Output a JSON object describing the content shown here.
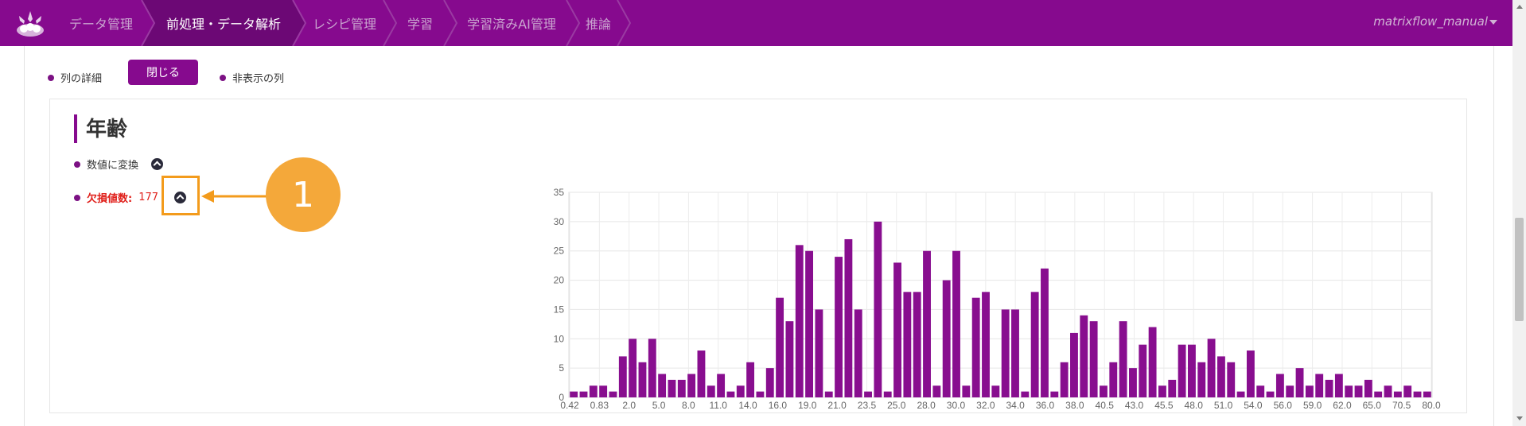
{
  "nav": {
    "items": [
      {
        "label": "データ管理",
        "active": false
      },
      {
        "label": "前処理・データ解析",
        "active": true
      },
      {
        "label": "レシピ管理",
        "active": false
      },
      {
        "label": "学習",
        "active": false
      },
      {
        "label": "学習済みAI管理",
        "active": false
      },
      {
        "label": "推論",
        "active": false
      }
    ],
    "user": "matrixflow_manual"
  },
  "toolbar": {
    "column_detail": "列の詳細",
    "close_button": "閉じる",
    "hidden_columns": "非表示の列"
  },
  "column": {
    "title": "年齢",
    "convert_numeric": "数値に変換",
    "missing_label": "欠損値数:",
    "missing_count": "177"
  },
  "annotation": {
    "number": "1"
  },
  "colors": {
    "brand": "#860a8e",
    "bar": "#880e8f",
    "accent": "#f4a83a"
  },
  "chart_data": {
    "type": "bar",
    "x_tick_labels": [
      "0.42",
      "0.83",
      "2.0",
      "5.0",
      "8.0",
      "11.0",
      "14.0",
      "16.0",
      "19.0",
      "21.0",
      "23.5",
      "25.0",
      "28.0",
      "30.0",
      "32.0",
      "34.0",
      "36.0",
      "38.0",
      "40.5",
      "43.0",
      "45.5",
      "48.0",
      "51.0",
      "54.0",
      "56.0",
      "59.0",
      "62.0",
      "65.0",
      "70.5",
      "80.0"
    ],
    "y_ticks": [
      0,
      5,
      10,
      15,
      20,
      25,
      30,
      35
    ],
    "ylim": [
      0,
      35
    ],
    "grid": true,
    "values": [
      1,
      1,
      2,
      2,
      1,
      7,
      10,
      6,
      10,
      4,
      3,
      3,
      4,
      8,
      2,
      4,
      1,
      2,
      6,
      1,
      5,
      17,
      13,
      26,
      25,
      15,
      1,
      24,
      27,
      15,
      1,
      30,
      1,
      23,
      18,
      18,
      25,
      2,
      20,
      25,
      2,
      17,
      18,
      2,
      15,
      15,
      1,
      18,
      22,
      1,
      6,
      11,
      14,
      13,
      2,
      6,
      13,
      5,
      9,
      12,
      2,
      3,
      9,
      9,
      6,
      10,
      7,
      6,
      1,
      8,
      2,
      1,
      4,
      2,
      5,
      2,
      4,
      3,
      4,
      2,
      2,
      3,
      1,
      2,
      1,
      2,
      1,
      1
    ]
  }
}
